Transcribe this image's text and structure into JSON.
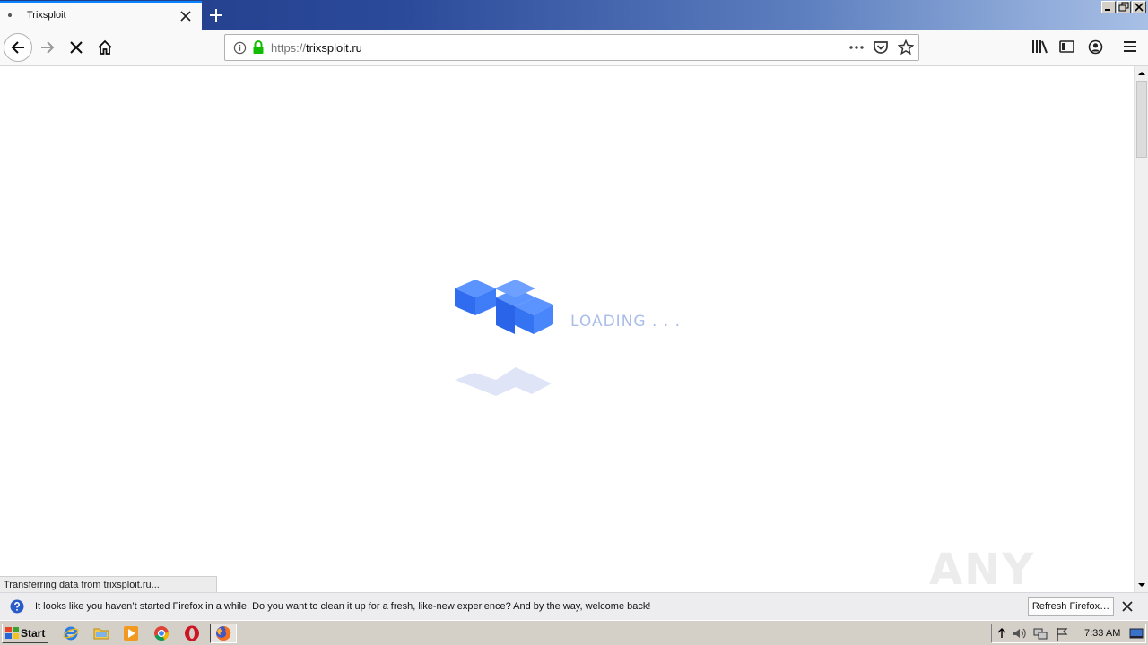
{
  "browser": {
    "tab": {
      "title": "Trixsploit"
    },
    "urlbar": {
      "scheme": "https://",
      "host": "trixsploit.ru"
    },
    "status": "Transferring data from trixsploit.ru..."
  },
  "page": {
    "loading_text": "LOADING . . ."
  },
  "notification": {
    "message": "It looks like you haven’t started Firefox in a while. Do you want to clean it up for a fresh, like-new experience? And by the way, welcome back!",
    "button_label": "Refresh Firefox…"
  },
  "taskbar": {
    "start_label": "Start",
    "clock": "7:33 AM"
  },
  "watermark": "ANY RUN",
  "colors": {
    "accent": "#0a84ff",
    "loader_blue": "#3d7ff5",
    "titlebar": "#1f3a87"
  },
  "icons": {
    "back": "arrow-left-icon",
    "forward": "arrow-right-icon",
    "stop": "close-icon",
    "home": "home-icon",
    "info": "info-icon",
    "lock": "lock-icon",
    "library": "library-icon",
    "sidebar": "sidebar-icon",
    "account": "account-icon",
    "menu": "hamburger-icon"
  }
}
